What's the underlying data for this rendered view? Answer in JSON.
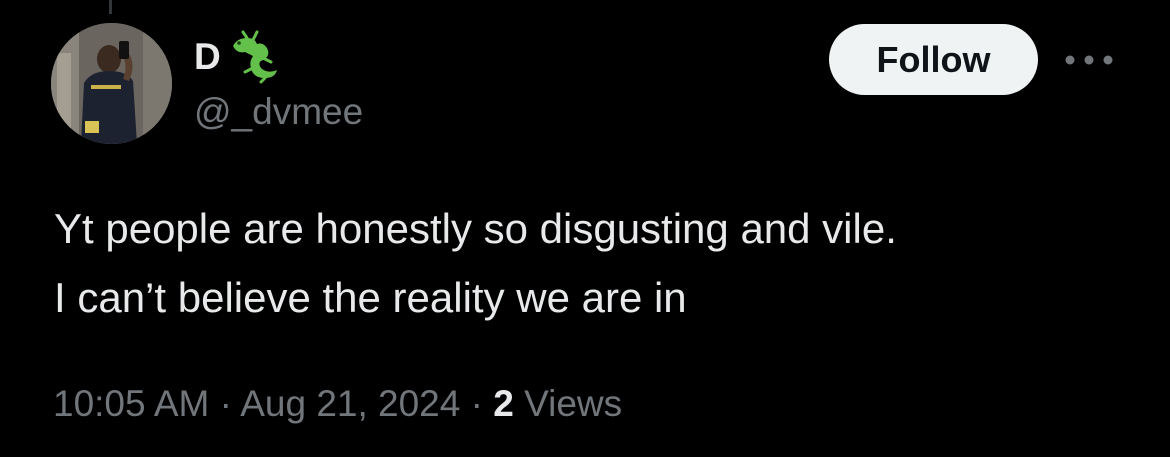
{
  "author": {
    "display_name": "D",
    "badge_emoji": "lizard",
    "handle": "@_dvmee"
  },
  "actions": {
    "follow_label": "Follow",
    "more_icon": "more-horizontal-icon"
  },
  "tweet": {
    "text_lines": [
      "Yt people are honestly so disgusting and vile.",
      "I can’t believe the reality we are in"
    ]
  },
  "meta": {
    "time": "10:05 AM",
    "separator": "·",
    "date": "Aug 21, 2024",
    "views_count": "2",
    "views_label": "Views"
  },
  "colors": {
    "background": "#000000",
    "primary_text": "#e7e9ea",
    "secondary_text": "#71767b",
    "follow_bg": "#eff3f4",
    "follow_text": "#0f1419",
    "emoji_green": "#63c04a"
  }
}
